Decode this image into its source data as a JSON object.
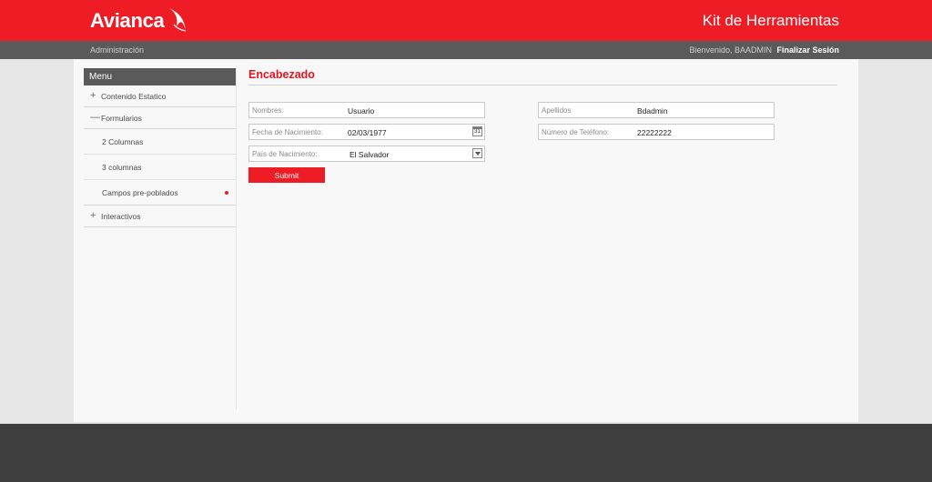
{
  "header": {
    "logo_text": "Avianca",
    "app_title": "Kit de Herramientas"
  },
  "subbar": {
    "admin_label": "Administración",
    "welcome_text": "Bienvenido, BAADMIN",
    "logout_label": "Finalizar Sesión"
  },
  "sidebar": {
    "title": "Menu",
    "items": [
      {
        "label": "Contenido Estatico",
        "sign": "+"
      },
      {
        "label": "Formularios",
        "sign": "—"
      },
      {
        "label": "Interactivos",
        "sign": "+"
      }
    ],
    "subitems": [
      {
        "label": "2 Columnas"
      },
      {
        "label": "3 columnas"
      },
      {
        "label": "Campos pre-poblados"
      }
    ]
  },
  "main": {
    "title": "Encabezado",
    "fields": {
      "nombres": {
        "label": "Nombres:",
        "value": "Usuario"
      },
      "apellidos": {
        "label": "Apellidos",
        "value": "Bdadmin"
      },
      "fecha": {
        "label": "Fecha de Nacimiento:",
        "value": "02/03/1977",
        "icon": "calendar-icon",
        "icon_text": "31"
      },
      "telefono": {
        "label": "Número de Teléfono:",
        "value": "22222222"
      },
      "pais": {
        "label": "País de Nacimiento:",
        "value": "El Salvador",
        "icon": "dropdown-arrow-icon"
      }
    },
    "submit_label": "Submit"
  },
  "colors": {
    "brand_red": "#ee1c25",
    "dark_gray": "#5a5a5a",
    "footer": "#3f3f3f"
  }
}
